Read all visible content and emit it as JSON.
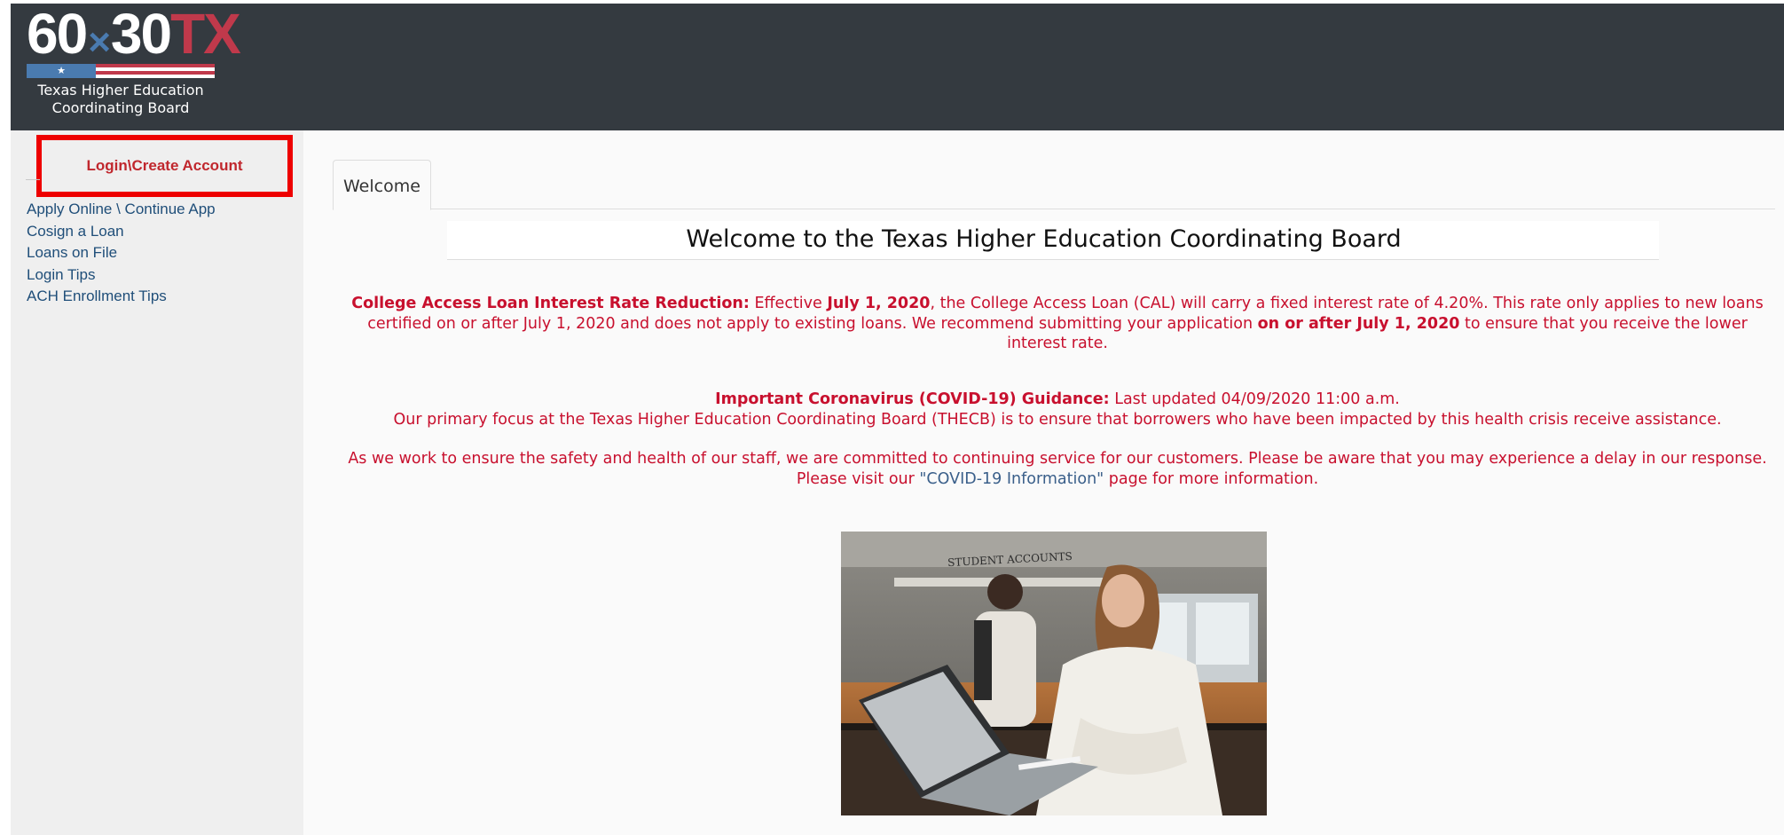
{
  "header": {
    "logo": {
      "mark_number_a": "60",
      "mark_times": "×",
      "mark_number_b": "30",
      "mark_state": "TX",
      "title_line1": "Texas Higher Education",
      "title_line2": "Coordinating Board"
    }
  },
  "sidebar": {
    "login_label": "Login\\Create Account",
    "items": [
      {
        "label": "Apply Online \\ Continue App"
      },
      {
        "label": "Cosign a Loan"
      },
      {
        "label": "Loans on File"
      },
      {
        "label": "Login Tips"
      },
      {
        "label": "ACH Enrollment Tips"
      }
    ]
  },
  "main": {
    "tabs": [
      {
        "label": "Welcome"
      }
    ],
    "title": "Welcome to the Texas Higher Education Coordinating Board",
    "rate_notice": {
      "heading": "College Access Loan Interest Rate Reduction:",
      "text1": " Effective ",
      "date1": "July 1, 2020",
      "text2": ", the College Access Loan (CAL) will carry a fixed interest rate of 4.20%. This rate only applies to new loans certified on or after July 1, 2020 and does not apply to existing loans. We recommend submitting your application ",
      "date2": "on or after July 1, 2020",
      "text3": " to ensure that you receive the lower interest rate."
    },
    "covid_notice": {
      "heading": "Important Coronavirus (COVID-19) Guidance:",
      "updated": " Last updated 04/09/2020 11:00 a.m.",
      "line2": "Our primary focus at the Texas Higher Education Coordinating Board (THECB) is to ensure that borrowers who have been impacted by this health crisis receive assistance."
    },
    "staff_notice": {
      "text1": "As we work to ensure the safety and health of our staff, we are committed to continuing service for our customers. Please be aware that you may experience a delay in our response. Please visit our ",
      "link": "\"COVID-19 Information\"",
      "text2": " page for more information."
    },
    "photo": {
      "sign": "STUDENT ACCOUNTS"
    }
  },
  "colors": {
    "header_bg": "#343a40",
    "sidebar_bg": "#efefef",
    "notice_red": "#c8102e",
    "nav_link": "#1f4e79",
    "highlight_box": "#ee0000"
  }
}
